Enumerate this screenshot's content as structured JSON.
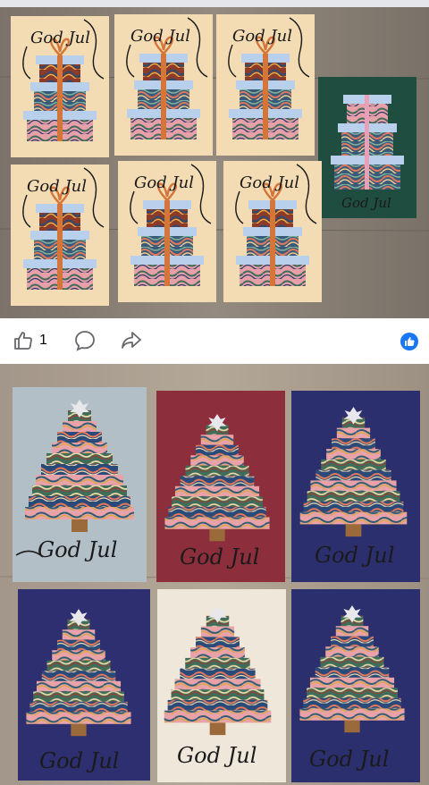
{
  "photo_top": {
    "alt": "Photo of Christmas cards with stacked gift boxes",
    "card_greeting": "God Jul"
  },
  "photo_bottom": {
    "alt": "Photo of Christmas cards with marbled paper trees",
    "card_greeting": "God Jul"
  },
  "actions": {
    "like_icon": "thumbs-up-icon",
    "like_count": "1",
    "comment_icon": "comment-bubble-icon",
    "share_icon": "share-arrow-icon",
    "reaction_icon": "like-reaction-icon"
  },
  "colors": {
    "reaction_blue": "#1877f2",
    "icon_gray": "#65676b"
  }
}
